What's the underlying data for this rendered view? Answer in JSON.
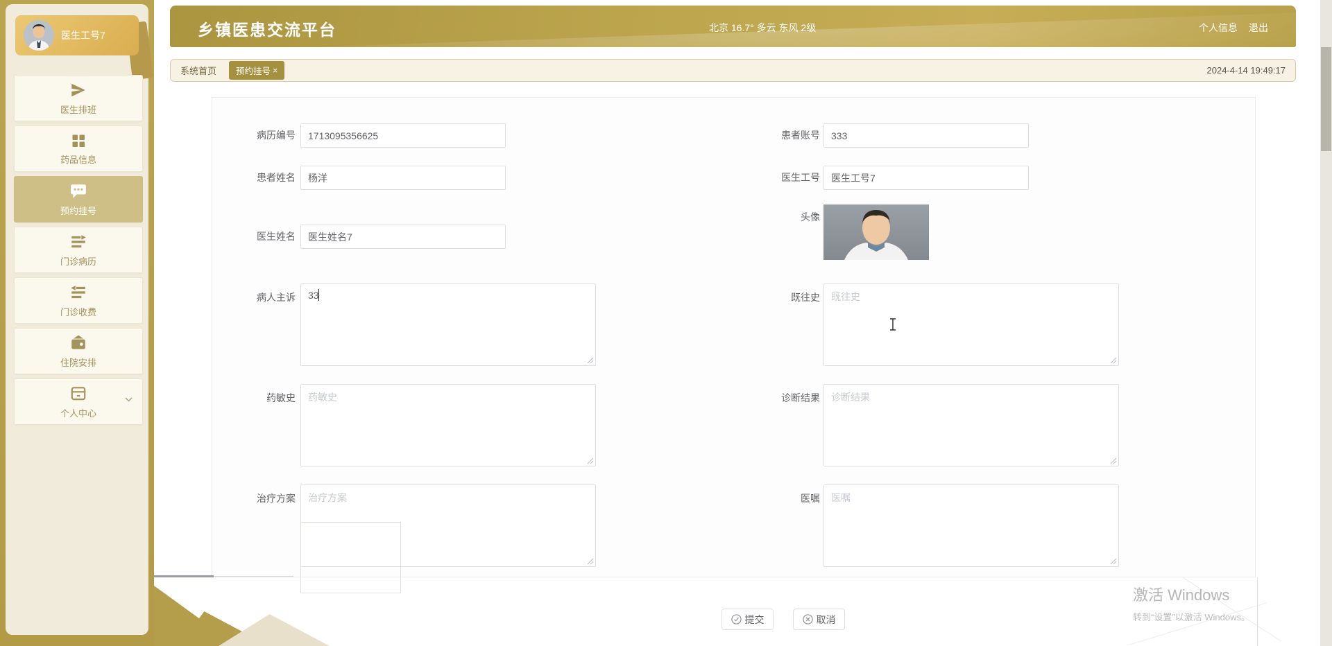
{
  "header": {
    "title": "乡镇医患交流平台",
    "weather": "北京 16.7° 多云 东风 2级",
    "profile_link": "个人信息",
    "logout_link": "退出"
  },
  "sidebar": {
    "user_name": "医生工号7",
    "items": [
      {
        "label": "医生排班",
        "icon": "send-icon",
        "active": false
      },
      {
        "label": "药品信息",
        "icon": "grid-icon",
        "active": false
      },
      {
        "label": "预约挂号",
        "icon": "chat-bubble-icon",
        "active": true
      },
      {
        "label": "门诊病历",
        "icon": "list-arrow-right-icon",
        "active": false
      },
      {
        "label": "门诊收费",
        "icon": "list-arrow-left-icon",
        "active": false
      },
      {
        "label": "住院安排",
        "icon": "wallet-icon",
        "active": false
      },
      {
        "label": "个人中心",
        "icon": "account-card-icon",
        "active": false,
        "has_chevron": true
      }
    ]
  },
  "tabbar": {
    "home_tab": "系统首页",
    "active_tab": "预约挂号",
    "close": "×",
    "timestamp": "2024-4-14 19:49:17"
  },
  "form": {
    "record_no": {
      "label": "病历编号",
      "value": "1713095356625"
    },
    "patient_account": {
      "label": "患者账号",
      "value": "333"
    },
    "patient_name": {
      "label": "患者姓名",
      "value": "杨洋"
    },
    "doctor_no": {
      "label": "医生工号",
      "value": "医生工号7"
    },
    "doctor_name": {
      "label": "医生姓名",
      "value": "医生姓名7"
    },
    "avatar": {
      "label": "头像"
    },
    "chief_complaint": {
      "label": "病人主诉",
      "value": "33"
    },
    "past_history": {
      "label": "既往史",
      "placeholder": "既往史"
    },
    "drug_allergy": {
      "label": "药敏史",
      "placeholder": "药敏史"
    },
    "diagnosis": {
      "label": "诊断结果",
      "placeholder": "诊断结果"
    },
    "treatment": {
      "label": "治疗方案",
      "placeholder": "治疗方案"
    },
    "doctor_advice": {
      "label": "医嘱",
      "placeholder": "医嘱"
    }
  },
  "buttons": {
    "submit": "提交",
    "cancel": "取消"
  },
  "watermark": {
    "line1": "激活 Windows",
    "line2": "转到“设置”以激活 Windows。"
  },
  "colors": {
    "gold": "#b7a14d",
    "gold_light": "#c6ad56",
    "sidebar_bg": "#f1ebdb",
    "active_item_bg": "#cdbf85",
    "tab_chip_bg": "#a59040",
    "menu_text": "#a3925a"
  }
}
